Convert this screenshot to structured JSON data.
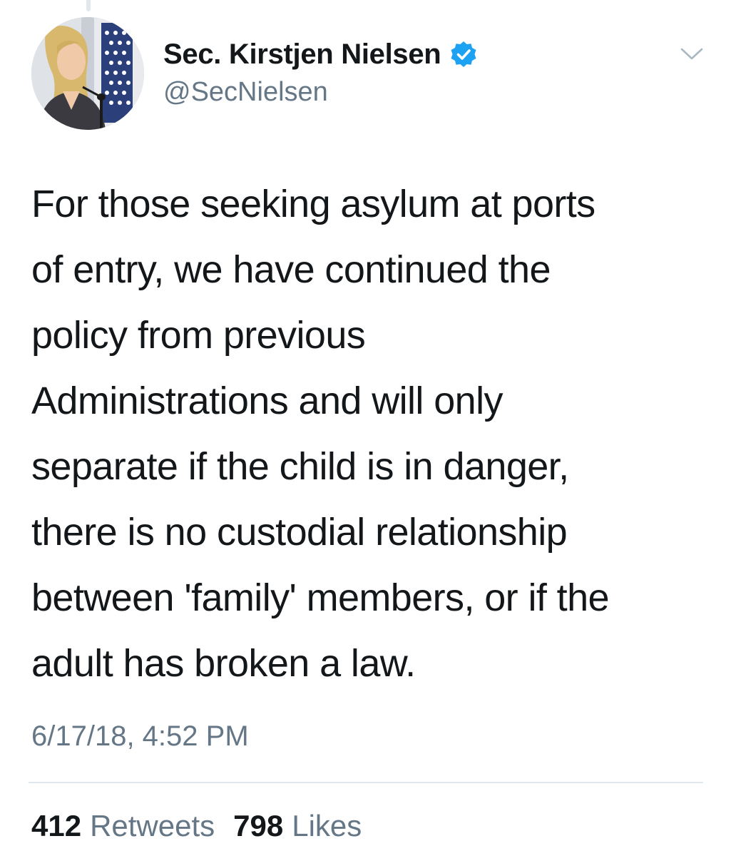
{
  "tweet": {
    "author": {
      "display_name": "Sec. Kirstjen Nielsen",
      "handle": "@SecNielsen",
      "verified": true
    },
    "text_lines": [
      "For those seeking asylum at ports",
      "of entry, we have continued the",
      "policy from previous",
      "Administrations and will only",
      "separate if the child is in danger,",
      "there is no custodial relationship",
      "between 'family' members, or if the",
      "adult has broken a law."
    ],
    "timestamp": "6/17/18, 4:52 PM",
    "stats": {
      "retweets_count": "412",
      "retweets_label": "Retweets",
      "likes_count": "798",
      "likes_label": "Likes"
    }
  },
  "icons": {
    "verified": "verified-badge-icon",
    "menu": "chevron-down-icon"
  },
  "colors": {
    "text_primary": "#14171a",
    "text_secondary": "#657786",
    "verified_blue": "#1da1f2",
    "divider": "#e1e8ed"
  }
}
